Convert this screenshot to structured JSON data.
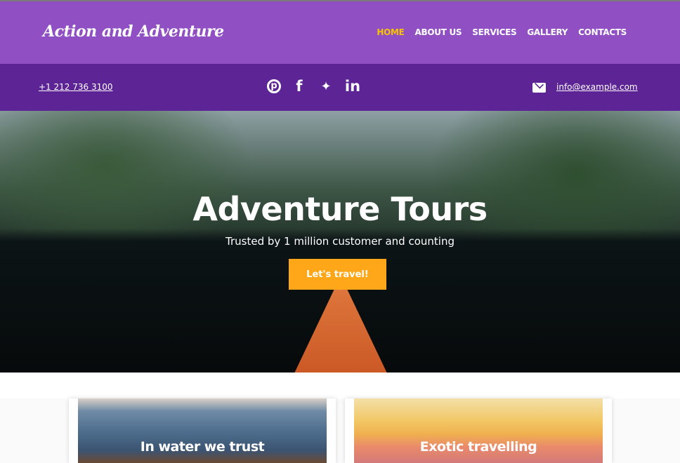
{
  "header": {
    "logo": "Action and Adventure",
    "nav": [
      {
        "label": "HOME",
        "active": true
      },
      {
        "label": "ABOUT US"
      },
      {
        "label": "SERVICES"
      },
      {
        "label": "GALLERY"
      },
      {
        "label": "CONTACTS"
      }
    ],
    "accent": "#f8c400"
  },
  "contact_bar": {
    "phone": "+1 212 736 3100",
    "email": "info@example.com",
    "social": [
      {
        "icon": "pinterest-icon",
        "glyph": "℗"
      },
      {
        "icon": "facebook-icon",
        "glyph": "f"
      },
      {
        "icon": "twitter-icon",
        "glyph": "🐦"
      },
      {
        "icon": "linkedin-icon",
        "glyph": "in"
      }
    ]
  },
  "hero": {
    "title": "Adventure Tours",
    "subtitle": "Trusted by 1 million customer and counting",
    "button": "Let's travel!",
    "button_color": "#ffa718"
  },
  "cards": [
    {
      "title": "In water we trust"
    },
    {
      "title": "Exotic travelling"
    }
  ]
}
